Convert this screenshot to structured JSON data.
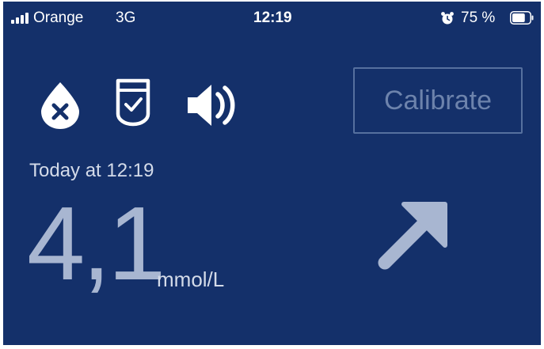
{
  "status_bar": {
    "carrier": "Orange",
    "network": "3G",
    "time": "12:19",
    "battery_percent": "75 %",
    "battery_level": 0.75,
    "icons": [
      "signal-icon",
      "alarm-icon",
      "battery-icon"
    ]
  },
  "status_icons": [
    "glucose-drop-error-icon",
    "sensor-ok-icon",
    "sound-on-icon"
  ],
  "calibrate": {
    "label": "Calibrate"
  },
  "reading": {
    "timestamp": "Today at 12:19",
    "value": "4,1",
    "unit": "mmol/L",
    "trend": "rising-up-right"
  },
  "colors": {
    "background": "#14306a",
    "value_text": "#a8b6d1",
    "secondary_text": "#d4dbe9",
    "disabled_button": "#6d83ac",
    "trend_arrow": "#a8b6d1"
  }
}
